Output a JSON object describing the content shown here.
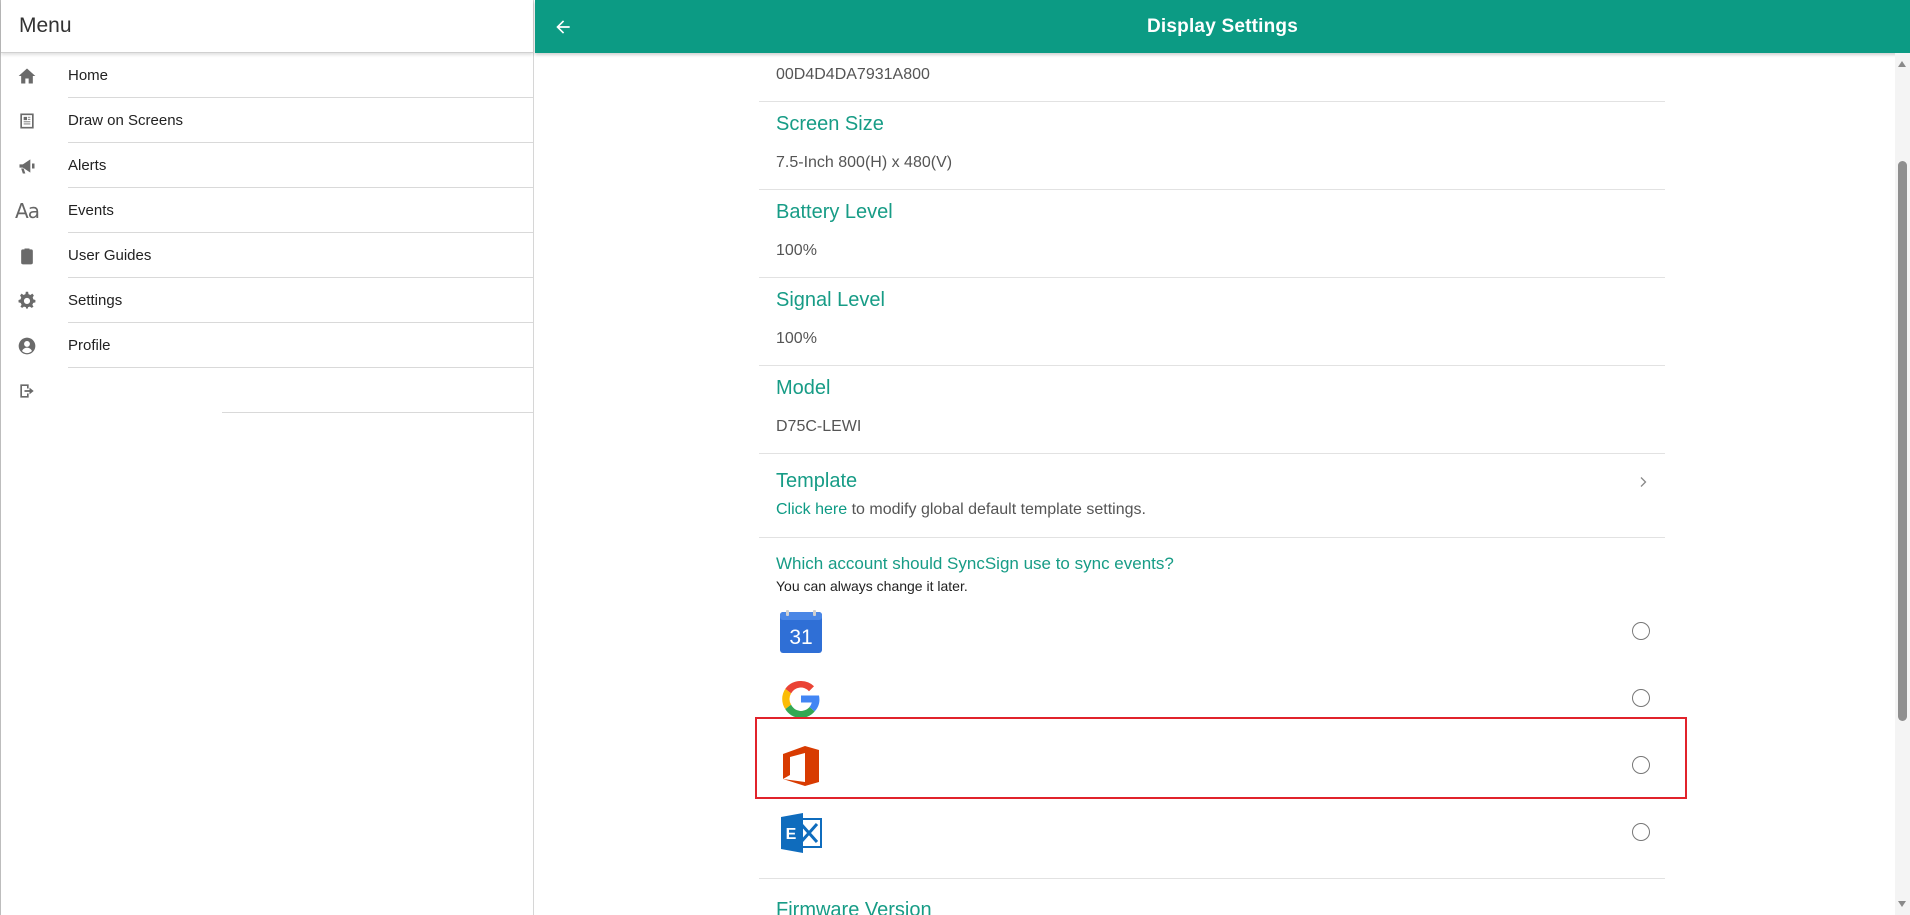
{
  "sidebar": {
    "title": "Menu",
    "items": [
      {
        "label": "Home",
        "icon": "home-icon"
      },
      {
        "label": "Draw on Screens",
        "icon": "newspaper-icon"
      },
      {
        "label": "Alerts",
        "icon": "megaphone-icon"
      },
      {
        "label": "Events",
        "icon": "font-aa-icon"
      },
      {
        "label": "User Guides",
        "icon": "clipboard-icon"
      },
      {
        "label": "Settings",
        "icon": "gear-icon"
      },
      {
        "label": "Profile",
        "icon": "user-circle-icon"
      },
      {
        "label": "",
        "icon": "sign-out-icon"
      }
    ]
  },
  "topbar": {
    "title": "Display Settings",
    "back_icon": "arrow-left-icon",
    "color": "#0c9b84"
  },
  "details": {
    "device_id": "00D4D4DA7931A800",
    "screen_size": {
      "label": "Screen Size",
      "value": "7.5-Inch 800(H) x 480(V)"
    },
    "battery_level": {
      "label": "Battery Level",
      "value": "100%"
    },
    "signal_level": {
      "label": "Signal Level",
      "value": "100%"
    },
    "model": {
      "label": "Model",
      "value": "D75C-LEWI"
    },
    "template": {
      "label": "Template",
      "link_text": "Click here",
      "rest_text": " to modify global default template settings."
    },
    "firmware_version": {
      "label": "Firmware Version"
    }
  },
  "sync": {
    "question": "Which account should SyncSign use to sync events?",
    "hint": "You can always change it later.",
    "accounts": [
      {
        "icon": "calendar-31-icon",
        "calendar_day": "31",
        "selected": false
      },
      {
        "icon": "google-g-icon",
        "selected": false
      },
      {
        "icon": "office-365-icon",
        "selected": false
      },
      {
        "icon": "exchange-icon",
        "exchange_letter": "E",
        "selected": false
      }
    ]
  },
  "colors": {
    "accent": "#0c9b84",
    "section_title": "#179c86",
    "highlight_border": "#e1232b"
  }
}
